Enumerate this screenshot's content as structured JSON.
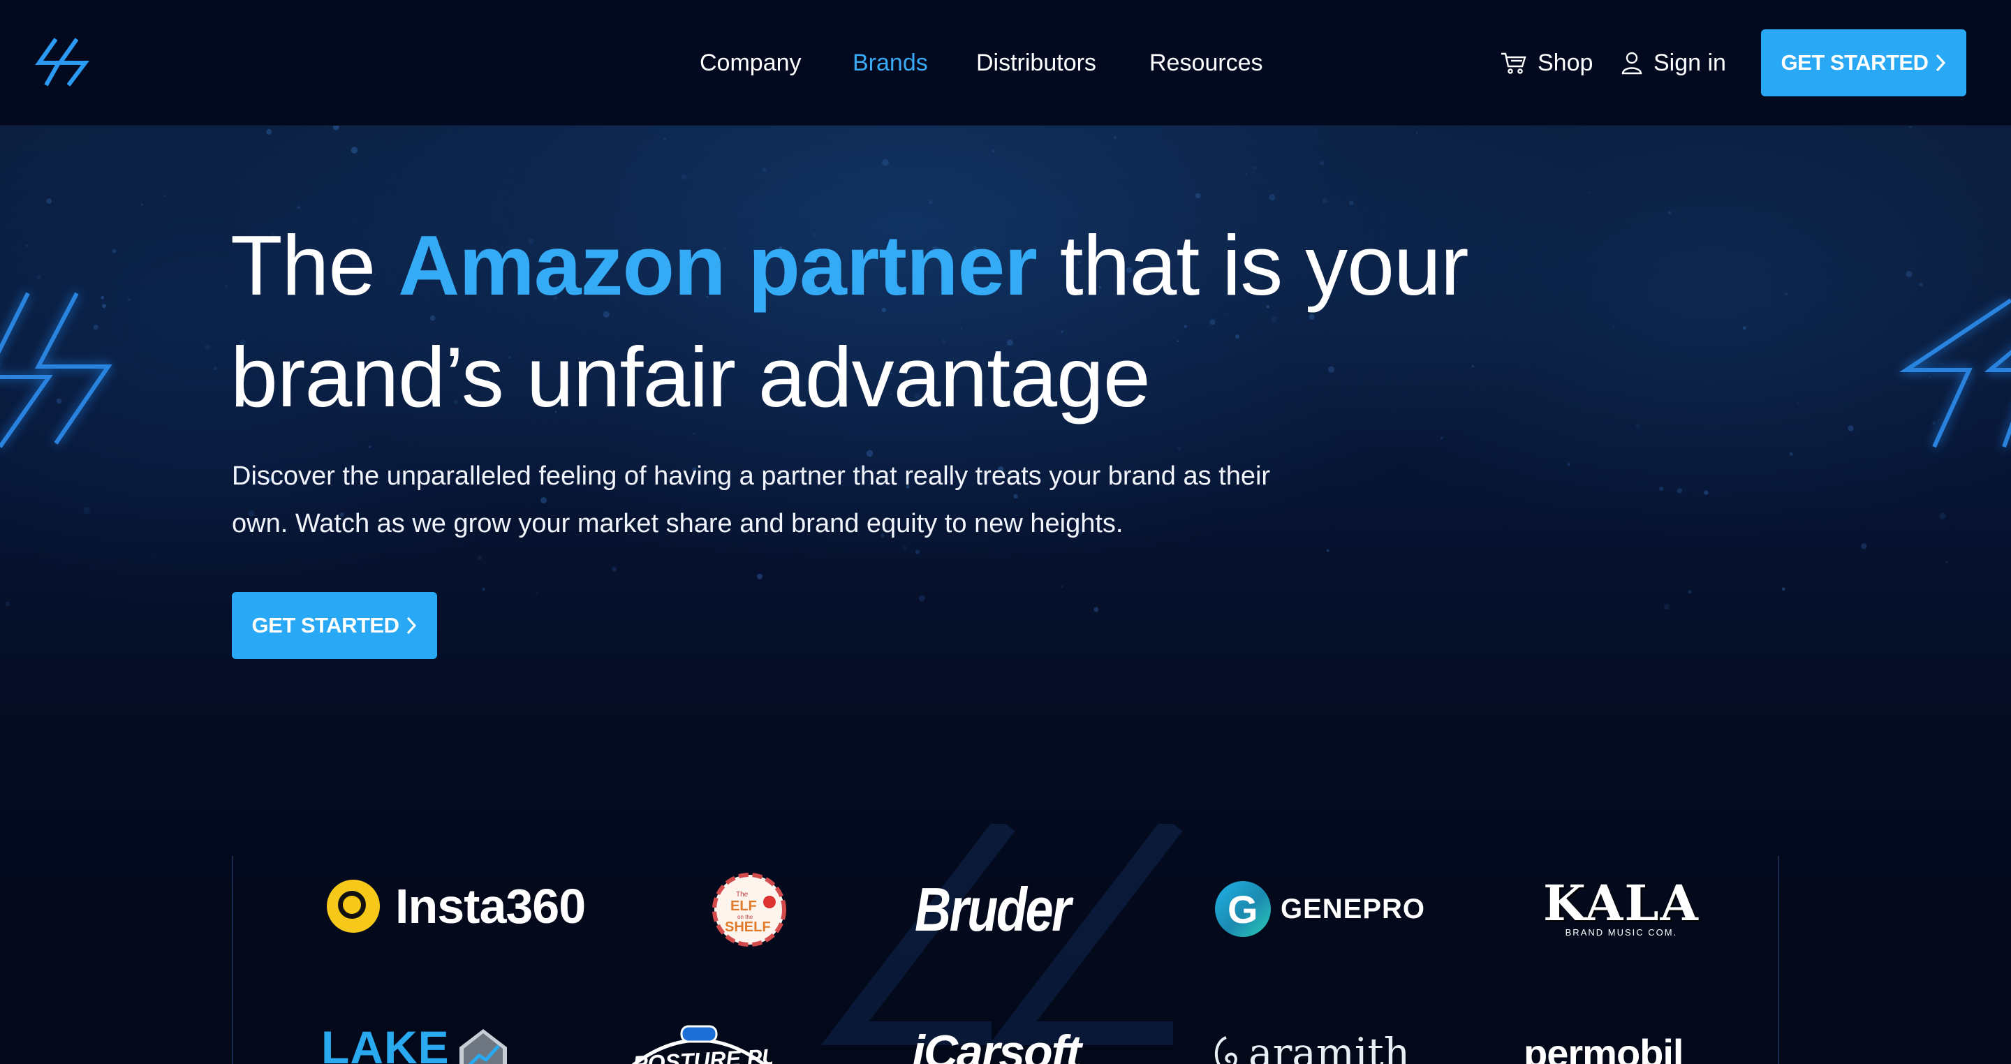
{
  "header": {
    "logo_name": "bolt-logo",
    "nav": [
      {
        "label": "Company",
        "active": false
      },
      {
        "label": "Brands",
        "active": true
      },
      {
        "label": "Distributors",
        "active": false
      },
      {
        "label": "Resources",
        "active": false
      }
    ],
    "shop_label": "Shop",
    "signin_label": "Sign in",
    "cta_label": "GET STARTED"
  },
  "hero": {
    "headline_pre": "The ",
    "headline_accent": "Amazon partner",
    "headline_post": " that is your brand’s unfair advantage",
    "subtext": "Discover the unparalleled feeling of having a partner that really treats your brand as their own. Watch as we grow your market share and brand equity to new heights.",
    "cta_label": "GET STARTED"
  },
  "brands": {
    "row1": [
      "Insta360",
      "The Elf on the Shelf",
      "Bruder",
      "GENEPRO",
      "KALA"
    ],
    "kala_tagline": "BRAND MUSIC COM.",
    "row2": [
      "LAKE",
      "Posture Pump",
      "iCarsoft",
      "aramith",
      "permobil"
    ],
    "elf_lines": [
      "The",
      "ELF",
      "on the",
      "SHELF"
    ],
    "posture_text": "POSTURE PUMP"
  },
  "colors": {
    "accent": "#29a8f5",
    "background": "#040b1f",
    "header_bg": "#030a1f"
  }
}
